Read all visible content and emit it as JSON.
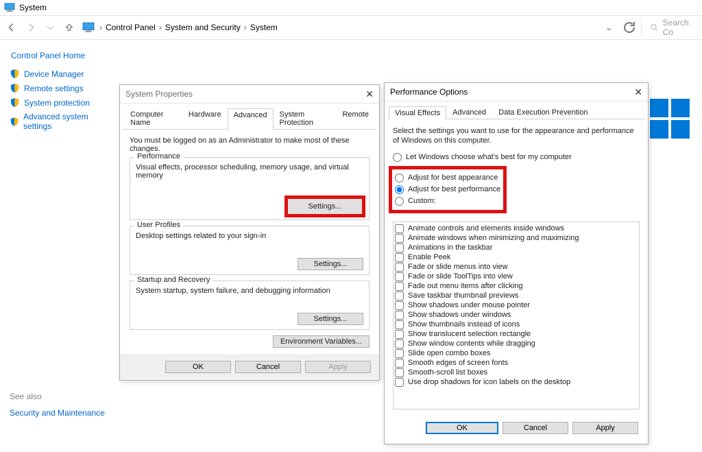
{
  "window": {
    "title": "System"
  },
  "breadcrumb": {
    "items": [
      "Control Panel",
      "System and Security",
      "System"
    ]
  },
  "search": {
    "placeholder": "Search Co"
  },
  "sidebar": {
    "home": "Control Panel Home",
    "links": [
      "Device Manager",
      "Remote settings",
      "System protection",
      "Advanced system settings"
    ],
    "see_also": "See also",
    "sm": "Security and Maintenance"
  },
  "sysprop": {
    "title": "System Properties",
    "tabs": [
      "Computer Name",
      "Hardware",
      "Advanced",
      "System Protection",
      "Remote"
    ],
    "active_tab": 2,
    "admin_note": "You must be logged on as an Administrator to make most of these changes.",
    "groups": {
      "perf": {
        "title": "Performance",
        "desc": "Visual effects, processor scheduling, memory usage, and virtual memory",
        "btn": "Settings..."
      },
      "profiles": {
        "title": "User Profiles",
        "desc": "Desktop settings related to your sign-in",
        "btn": "Settings..."
      },
      "startup": {
        "title": "Startup and Recovery",
        "desc": "System startup, system failure, and debugging information",
        "btn": "Settings..."
      }
    },
    "env_btn": "Environment Variables...",
    "ok": "OK",
    "cancel": "Cancel",
    "apply": "Apply"
  },
  "perfopt": {
    "title": "Performance Options",
    "tabs": [
      "Visual Effects",
      "Advanced",
      "Data Execution Prevention"
    ],
    "active_tab": 0,
    "intro": "Select the settings you want to use for the appearance and performance of Windows on this computer.",
    "radios": [
      "Let Windows choose what's best for my computer",
      "Adjust for best appearance",
      "Adjust for best performance",
      "Custom:"
    ],
    "selected_radio": 2,
    "checks": [
      "Animate controls and elements inside windows",
      "Animate windows when minimizing and maximizing",
      "Animations in the taskbar",
      "Enable Peek",
      "Fade or slide menus into view",
      "Fade or slide ToolTips into view",
      "Fade out menu items after clicking",
      "Save taskbar thumbnail previews",
      "Show shadows under mouse pointer",
      "Show shadows under windows",
      "Show thumbnails instead of icons",
      "Show translucent selection rectangle",
      "Show window contents while dragging",
      "Slide open combo boxes",
      "Smooth edges of screen fonts",
      "Smooth-scroll list boxes",
      "Use drop shadows for icon labels on the desktop"
    ],
    "ok": "OK",
    "cancel": "Cancel",
    "apply": "Apply"
  }
}
